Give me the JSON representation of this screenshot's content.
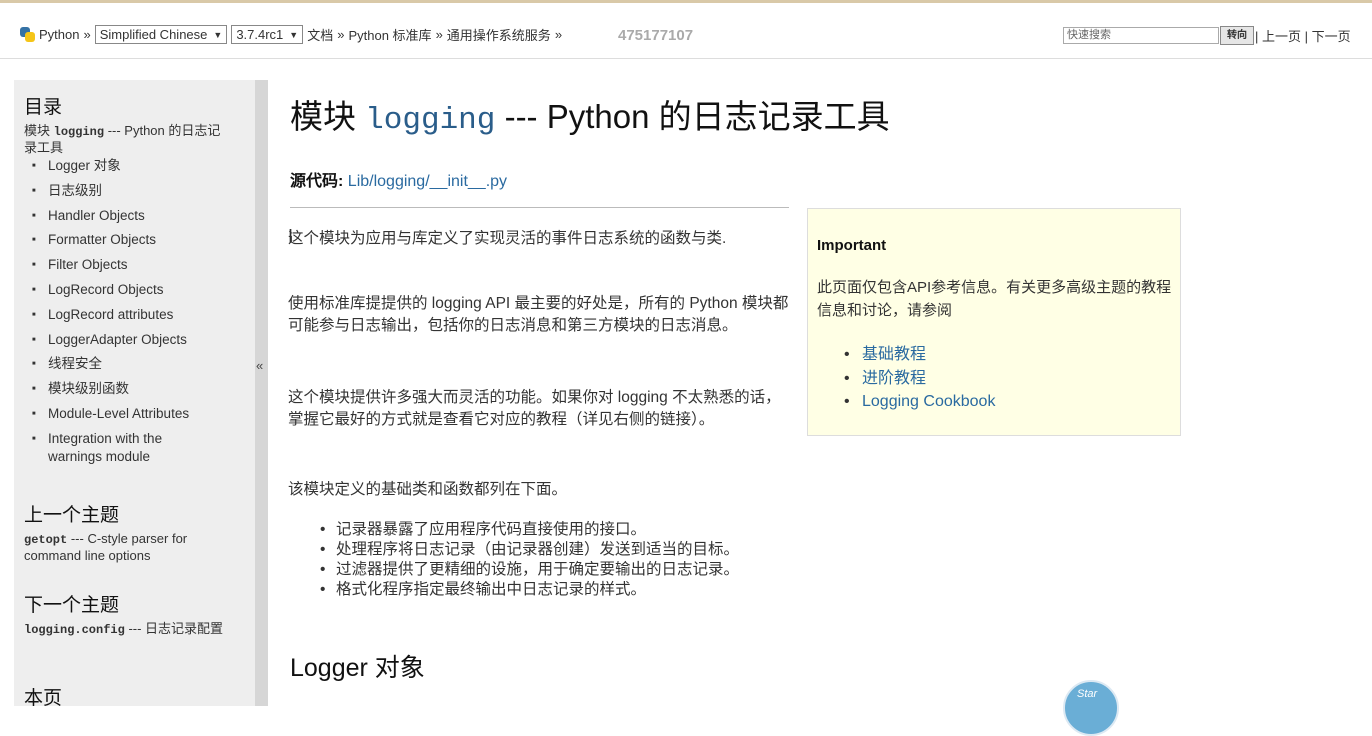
{
  "topbar": {
    "python_link": "Python",
    "sep1": "»",
    "language": "Simplified Chinese",
    "version": "3.7.4rc1",
    "crumb_docs": "文档",
    "sep2": "»",
    "crumb_stdlib": "Python 标准库",
    "sep3": "»",
    "crumb_os": "通用操作系统服务",
    "sep4": "»",
    "search_placeholder": "快速搜索",
    "go_label": "转向",
    "prev_label": "上一页",
    "nav_sep1": "|",
    "nav_sep2": "|",
    "next_label": "下一页"
  },
  "watermark": "475177107",
  "sidebar": {
    "toc_heading": "目录",
    "toc_module_prefix": "模块",
    "toc_module_code": "logging",
    "toc_module_rest": "--- Python 的日志记录工具",
    "toc_items": [
      "Logger 对象",
      "日志级别",
      "Handler Objects",
      "Formatter Objects",
      "Filter Objects",
      "LogRecord Objects",
      "LogRecord attributes",
      "LoggerAdapter Objects",
      "线程安全",
      "模块级别函数",
      "Module-Level Attributes",
      "Integration with the warnings module"
    ],
    "prev_heading": "上一个主题",
    "prev_code": "getopt",
    "prev_rest": "--- C-style parser for command line options",
    "next_heading": "下一个主题",
    "next_code": "logging.config",
    "next_rest": "--- 日志记录配置",
    "thispage_heading": "本页",
    "collapse_glyph": "«"
  },
  "main": {
    "title_prefix": "模块",
    "title_code": "logging",
    "title_rest": "--- Python 的日志记录工具",
    "source_label": "源代码:",
    "source_link": "Lib/logging/__init__.py",
    "paragraphs": [
      "这个模块为应用与库定义了实现灵活的事件日志系统的函数与类.",
      "使用标准库提提供的 logging API 最主要的好处是，所有的 Python 模块都可能参与日志输出，包括你的日志消息和第三方模块的日志消息。",
      "这个模块提供许多强大而灵活的功能。如果你对 logging 不太熟悉的话， 掌握它最好的方式就是查看它对应的教程（详见右侧的链接）。",
      "该模块定义的基础类和函数都列在下面。"
    ],
    "bullets": [
      "记录器暴露了应用程序代码直接使用的接口。",
      "处理程序将日志记录（由记录器创建）发送到适当的目标。",
      "过滤器提供了更精细的设施，用于确定要输出的日志记录。",
      "格式化程序指定最终输出中日志记录的样式。"
    ],
    "section_heading": "Logger 对象"
  },
  "important": {
    "title": "Important",
    "body": "此页面仅包含API参考信息。有关更多高级主题的教程信息和讨论，请参阅",
    "links": [
      "基础教程",
      "进阶教程",
      "Logging Cookbook"
    ]
  },
  "badge_text": "Star",
  "colors": {
    "link": "#2a6aa0",
    "sidebar_bg": "#eeeeee",
    "important_bg": "#ffffe5"
  }
}
